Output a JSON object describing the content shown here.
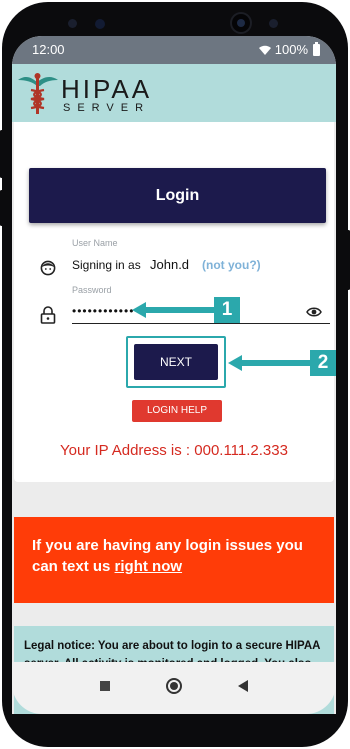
{
  "status_bar": {
    "time": "12:00",
    "battery": "100%"
  },
  "header": {
    "logo_main": "HIPAA",
    "logo_sub": "SERVER"
  },
  "login": {
    "title": "Login",
    "username_label": "User Name",
    "signing_in_as": "Signing in as",
    "username": "John.d",
    "not_you": "(not you?)",
    "password_label": "Password",
    "password_value": "••••••••••••",
    "next_label": "NEXT",
    "help_label": "LOGIN HELP",
    "ip_text": "Your IP Address is : 000.111.2.333"
  },
  "callouts": {
    "first": "1",
    "second": "2"
  },
  "issue_banner": {
    "text": "If you are having any login issues you can text us",
    "link": "right now"
  },
  "legal": {
    "text": "Legal notice: You are about to login to a secure HIPAA server. All activity is monitored and logged. You also agree to terms of use and our ability to track all"
  },
  "colors": {
    "brand_navy": "#1c1a4c",
    "header_teal": "#b1dcdb",
    "callout_teal": "#2ba8ac",
    "alert_red": "#e0392f",
    "banner_orange": "#ff3c08"
  },
  "icons": [
    "wifi-icon",
    "battery-icon",
    "caduceus-icon",
    "face-icon",
    "lock-icon",
    "eye-icon",
    "recent-apps-icon",
    "home-icon",
    "back-icon"
  ]
}
